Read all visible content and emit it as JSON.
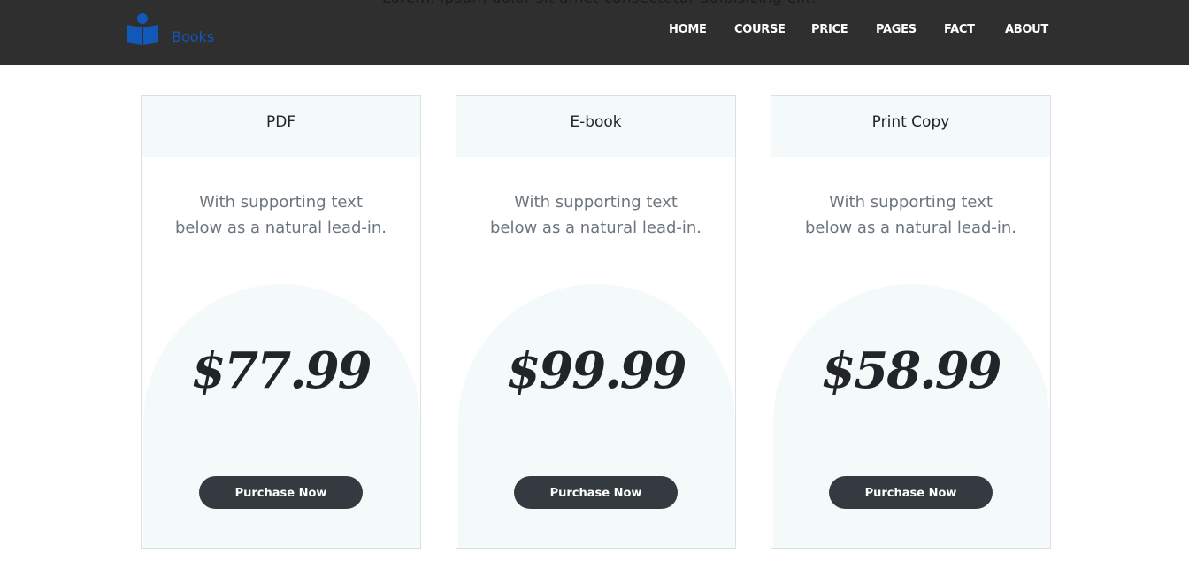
{
  "header": {
    "behind_text": "Lorem, ipsum dolor sit amet consectetur adipisicing elit.",
    "logo_text": "Books",
    "nav": [
      "HOME",
      "COURSE",
      "PRICE",
      "PAGES",
      "FACT",
      "ABOUT"
    ]
  },
  "colors": {
    "navbar_bg": "#2f2f2f",
    "brand": "#1258b8",
    "card_tint": "#f4f9fa",
    "button_bg": "#343a40"
  },
  "pricing": [
    {
      "title": "PDF",
      "text_lines": [
        "With supporting text",
        "below as a natural lead-in."
      ],
      "price": "$77.99",
      "button_label": "Purchase Now"
    },
    {
      "title": "E-book",
      "text_lines": [
        "With supporting text",
        "below as a natural lead-in."
      ],
      "price": "$99.99",
      "button_label": "Purchase Now"
    },
    {
      "title": "Print Copy",
      "text_lines": [
        "With supporting text",
        "below as a natural lead-in."
      ],
      "price": "$58.99",
      "button_label": "Purchase Now"
    }
  ]
}
